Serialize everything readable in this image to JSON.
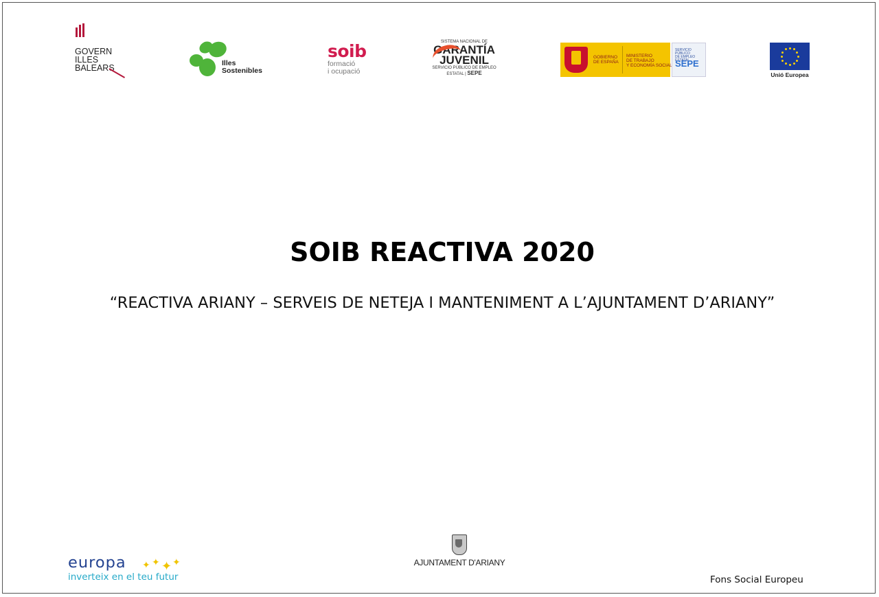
{
  "header_logos": {
    "govern": {
      "lines": [
        "GOVERN",
        "ILLES",
        "BALEARS"
      ],
      "color": "#b4183c"
    },
    "illes_sostenibles": {
      "lines": [
        "Illes",
        "Sostenibles"
      ],
      "color": "#4fb43a"
    },
    "soib": {
      "brand": "soib",
      "lines": [
        "formació",
        "i ocupació"
      ],
      "color": "#d11c4f"
    },
    "garantia_juvenil": {
      "top": "SISTEMA NACIONAL DE",
      "lines": [
        "GARANTÍA",
        "JUVENIL"
      ],
      "foot_small": "SERVICIO PÚBLICO DE EMPLEO ESTATAL",
      "foot_brand": "SEPE"
    },
    "gobierno": {
      "gov_lines": [
        "GOBIERNO",
        "DE ESPAÑA"
      ],
      "min_lines": [
        "MINISTERIO",
        "DE TRABAJO",
        "Y ECONOMÍA SOCIAL"
      ],
      "sepe_small": [
        "SERVICIO PÚBLICO",
        "DE EMPLEO ESTATAL"
      ],
      "sepe": "SEPE",
      "color": "#f4c400"
    },
    "eu": {
      "label": "Unió Europea",
      "color": "#1a3b9c"
    }
  },
  "title": "SOIB REACTIVA 2020",
  "subtitle": "“REACTIVA ARIANY – SERVEIS DE NETEJA I MANTENIMENT A L’AJUNTAMENT D’ARIANY”",
  "footer": {
    "europa": {
      "word": "europa",
      "tagline": "inverteix en el teu futur"
    },
    "ajuntament": {
      "name": "AJUNTAMENT D'ARIANY"
    },
    "fons": "Fons Social Europeu"
  }
}
